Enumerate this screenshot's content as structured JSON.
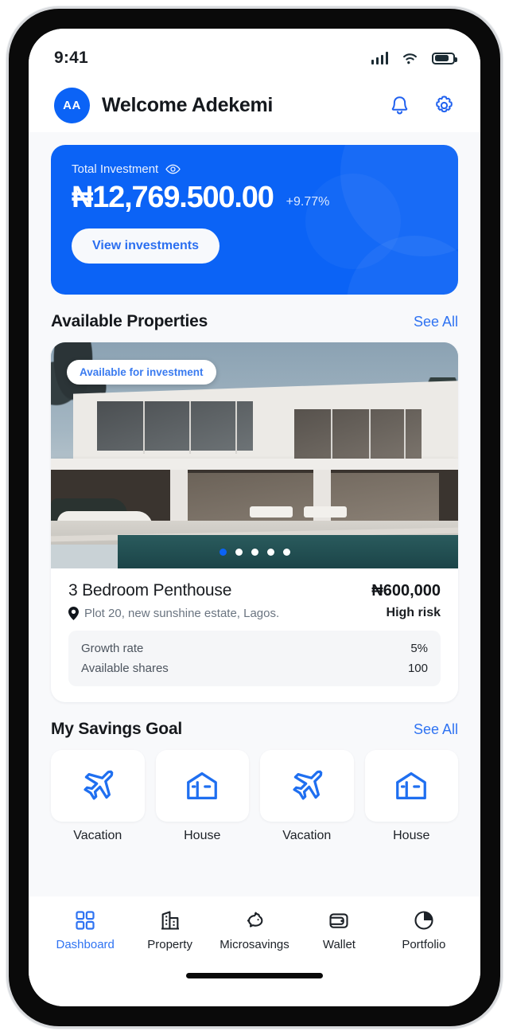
{
  "status_bar": {
    "time": "9:41",
    "signal_icon": "cellular-signal-icon",
    "wifi_icon": "wifi-icon",
    "battery_icon": "battery-icon"
  },
  "header": {
    "avatar_initials": "AA",
    "greeting": "Welcome Adekemi",
    "bell_icon": "notification-bell-icon",
    "settings_icon": "gear-icon"
  },
  "balance_card": {
    "label": "Total Investment",
    "eye_icon": "eye-icon",
    "amount": "₦12,769.500.00",
    "change": "+9.77%",
    "button_label": "View investments",
    "accent_color": "#0b63f6"
  },
  "properties_section": {
    "title": "Available Properties",
    "see_all": "See All",
    "badge": "Available for investment",
    "carousel_dots": 5,
    "active_dot": 0,
    "property": {
      "name": "3 Bedroom Penthouse",
      "price": "₦600,000",
      "location_icon": "map-pin-icon",
      "location": "Plot 20, new sunshine estate, Lagos.",
      "risk": "High risk",
      "stats": [
        {
          "label": "Growth rate",
          "value": "5%"
        },
        {
          "label": "Available shares",
          "value": "100"
        }
      ]
    }
  },
  "savings_section": {
    "title": "My Savings Goal",
    "see_all": "See All",
    "goals": [
      {
        "label": "Vacation",
        "icon": "airplane-icon"
      },
      {
        "label": "House",
        "icon": "house-icon"
      },
      {
        "label": "Vacation",
        "icon": "airplane-icon"
      },
      {
        "label": "House",
        "icon": "house-icon"
      }
    ]
  },
  "bottom_nav": {
    "active_color": "#2f73f2",
    "items": [
      {
        "label": "Dashboard",
        "icon": "grid-squares-icon",
        "active": true
      },
      {
        "label": "Property",
        "icon": "building-icon",
        "active": false
      },
      {
        "label": "Microsavings",
        "icon": "piggy-bank-icon",
        "active": false
      },
      {
        "label": "Wallet",
        "icon": "wallet-icon",
        "active": false
      },
      {
        "label": "Portfolio",
        "icon": "pie-chart-icon",
        "active": false
      }
    ]
  }
}
